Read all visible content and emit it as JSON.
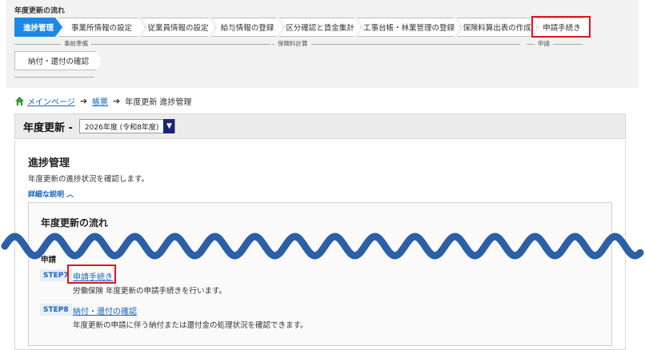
{
  "flow": {
    "title": "年度更新の流れ",
    "steps": [
      {
        "label": "進捗管理"
      },
      {
        "label": "事業所情報の設定"
      },
      {
        "label": "従業員情報の設定"
      },
      {
        "label": "給与情報の登録"
      },
      {
        "label": "区分確認と賃金集計"
      },
      {
        "label": "工事台帳・林業管理の登録"
      },
      {
        "label": "保険料算出表の作成"
      },
      {
        "label": "申請手続き"
      },
      {
        "label": "納付・還付の確認"
      }
    ],
    "phases": [
      "事前準備",
      "保険料計算",
      "申請"
    ]
  },
  "breadcrumb": {
    "home": "メインページ",
    "reports": "帳票",
    "current": "年度更新 進捗管理"
  },
  "fiscal": {
    "title": "年度更新 -",
    "selected_year": "2026年度 (令和8年度)"
  },
  "progress": {
    "title": "進捗管理",
    "description": "年度更新の進捗状況を確認します。",
    "detail_link": "詳細な説明 ︿"
  },
  "flow_section": {
    "title": "年度更新の流れ",
    "group": "申請",
    "items": [
      {
        "step": "STEP7",
        "link": "申請手続き",
        "desc": "労働保険 年度更新の申請手続きを行います。"
      },
      {
        "step": "STEP8",
        "link": "納付・還付の確認",
        "desc": "年度更新の申請に伴う納付または還付金の処理状況を確認できます。"
      }
    ]
  },
  "colors": {
    "accent": "#1e88e5",
    "highlight": "#e0161b",
    "wave": "#2b5fa8"
  }
}
